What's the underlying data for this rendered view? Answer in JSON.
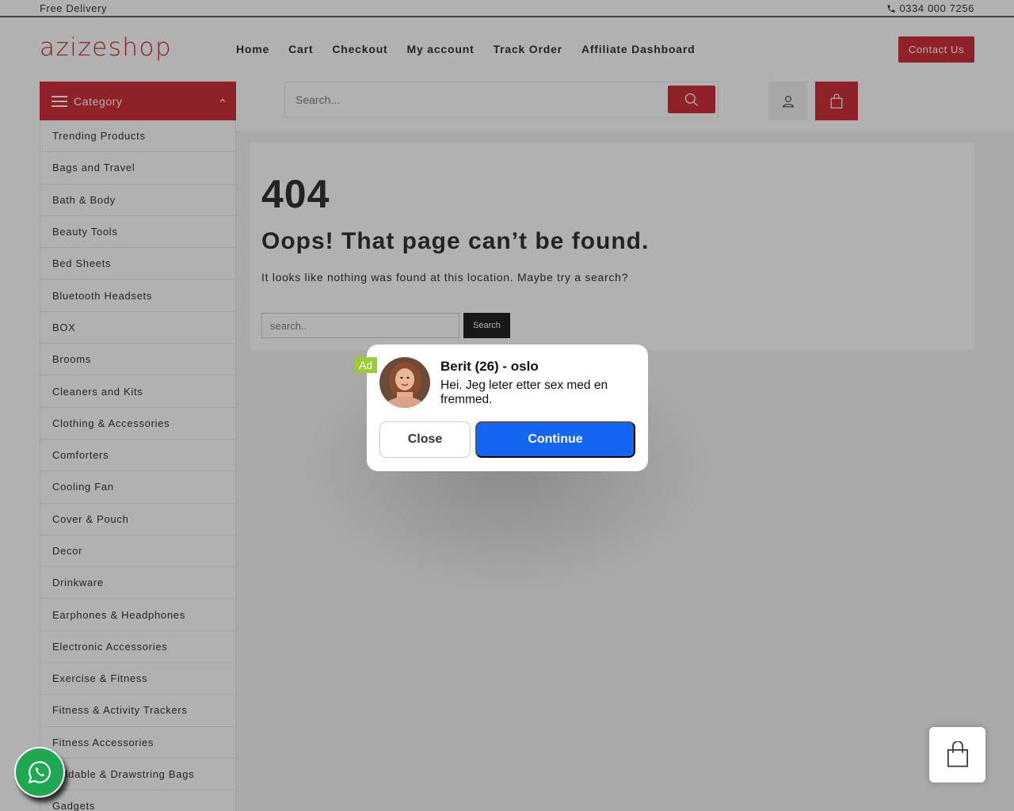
{
  "topbar": {
    "left_text": "Free Delivery",
    "phone": "0334 000 7256",
    "phone_icon": "phone-icon"
  },
  "header": {
    "logo": "azizeshop",
    "nav": [
      "Home",
      "Cart",
      "Checkout",
      "My account",
      "Track Order",
      "Affiliate Dashboard"
    ],
    "contact_label": "Contact Us",
    "category_label": "Category",
    "search_placeholder": "Search...",
    "icons": [
      "menu-icon",
      "chevron-up-icon",
      "search-icon",
      "user-icon",
      "shopping-bag-icon"
    ]
  },
  "sidebar": {
    "categories": [
      "Trending Products",
      "Bags and Travel",
      "Bath & Body",
      "Beauty Tools",
      "Bed Sheets",
      "Bluetooth Headsets",
      "BOX",
      "Brooms",
      "Cleaners and Kits",
      "Clothing & Accessories",
      "Comforters",
      "Cooling Fan",
      "Cover & Pouch",
      "Decor",
      "Drinkware",
      "Earphones & Headphones",
      "Electronic Accessories",
      "Exercise & Fitness",
      "Fitness & Activity Trackers",
      "Fitness Accessories",
      "Foldable & Drawstring Bags",
      "Gadgets"
    ]
  },
  "main": {
    "code": "404",
    "title": "Oops! That page can’t be found.",
    "message": "It looks like nothing was found at this location. Maybe try a search?",
    "search_placeholder": "search..",
    "search_button": "Search"
  },
  "ad": {
    "tag": "Ad",
    "name": "Berit (26) - oslo",
    "text": "Hei. Jeg leter etter sex med en fremmed.",
    "close_label": "Close",
    "continue_label": "Continue"
  },
  "widgets": {
    "whatsapp_icon": "whatsapp-icon",
    "mini_cart_icon": "shopping-bag-icon"
  },
  "colors": {
    "brand_red": "#c8202a",
    "continue_blue": "#1565f5",
    "ad_tag_green": "#9acd32",
    "whatsapp_green": "#1da851"
  }
}
